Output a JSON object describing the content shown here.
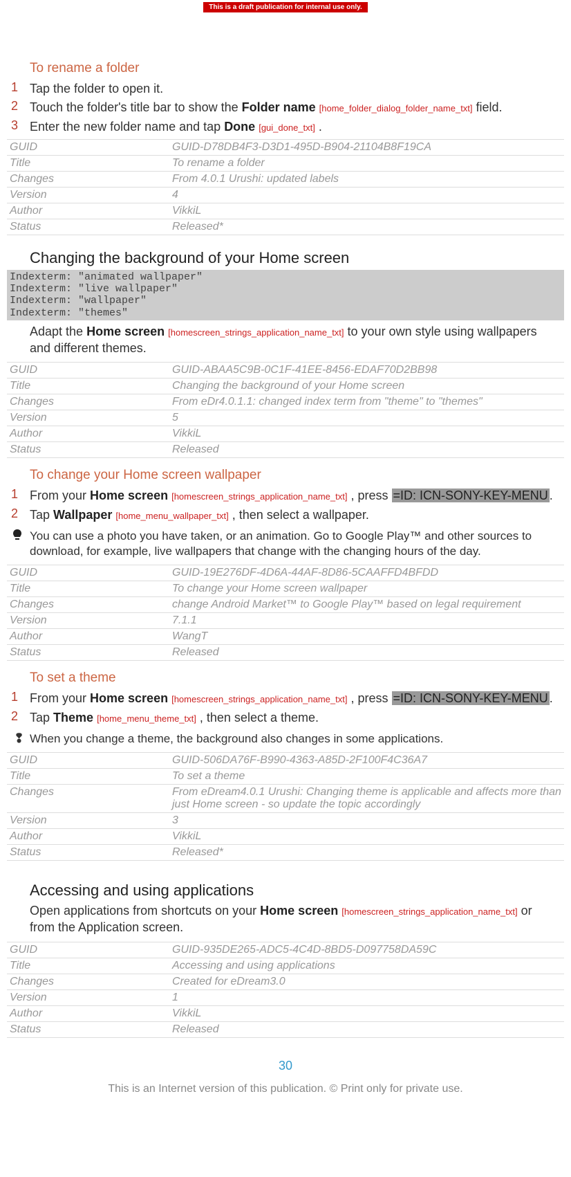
{
  "banner": "This is a draft publication for internal use only.",
  "sections": {
    "rename": {
      "heading": "To rename a folder",
      "steps": {
        "s1_text": "Tap the folder to open it.",
        "s2_pre": "Touch the folder's title bar to show the ",
        "s2_bold": "Folder name",
        "s2_ref": "[home_folder_dialog_folder_name_txt]",
        "s2_post": " field.",
        "s3_pre": "Enter the new folder name and tap ",
        "s3_bold": "Done",
        "s3_ref": "[gui_done_txt]",
        "s3_post": " ."
      },
      "meta": {
        "guid": "GUID-D78DB4F3-D3D1-495D-B904-21104B8F19CA",
        "title": "To rename a folder",
        "changes": "From 4.0.1 Urushi: updated labels",
        "version": "4",
        "author": "VikkiL",
        "status": "Released*"
      }
    },
    "changing_bg": {
      "heading": "Changing the background of your Home screen",
      "indexterms": "Indexterm: \"animated wallpaper\"\nIndexterm: \"live wallpaper\"\nIndexterm: \"wallpaper\"\nIndexterm: \"themes\"",
      "para_pre": "Adapt the ",
      "para_bold": "Home screen",
      "para_ref": "[homescreen_strings_application_name_txt]",
      "para_post": " to your own style using wallpapers and different themes.",
      "meta": {
        "guid": "GUID-ABAA5C9B-0C1F-41EE-8456-EDAF70D2BB98",
        "title": "Changing the background of your Home screen",
        "changes": "From eDr4.0.1.1: changed index term from \"theme\" to \"themes\"",
        "version": "5",
        "author": "VikkiL",
        "status": "Released"
      }
    },
    "change_wallpaper": {
      "heading": "To change your Home screen wallpaper",
      "steps": {
        "s1_pre": "From your ",
        "s1_bold": "Home screen",
        "s1_ref": "[homescreen_strings_application_name_txt]",
        "s1_mid": " , press ",
        "s1_icon": "=ID: ICN-SONY-KEY-MENU",
        "s1_post": ".",
        "s2_pre": "Tap ",
        "s2_bold": "Wallpaper",
        "s2_ref": "[home_menu_wallpaper_txt]",
        "s2_post": " , then select a wallpaper."
      },
      "tip": "You can use a photo you have taken, or an animation. Go to Google Play™ and other sources to download, for example, live wallpapers that change with the changing hours of the day.",
      "meta": {
        "guid": "GUID-19E276DF-4D6A-44AF-8D86-5CAAFFD4BFDD",
        "title": "To change your Home screen wallpaper",
        "changes": "change Android Market™ to Google Play™ based on legal requirement",
        "version": "7.1.1",
        "author": "WangT",
        "status": "Released"
      }
    },
    "set_theme": {
      "heading": "To set a theme",
      "steps": {
        "s1_pre": "From your ",
        "s1_bold": "Home screen",
        "s1_ref": "[homescreen_strings_application_name_txt]",
        "s1_mid": " , press ",
        "s1_icon": "=ID: ICN-SONY-KEY-MENU",
        "s1_post": ".",
        "s2_pre": "Tap ",
        "s2_bold": "Theme",
        "s2_ref": "[home_menu_theme_txt]",
        "s2_post": " , then select a theme."
      },
      "note": "When you change a theme, the background also changes in some applications.",
      "meta": {
        "guid": "GUID-506DA76F-B990-4363-A85D-2F100F4C36A7",
        "title": "To set a theme",
        "changes": "From eDream4.0.1 Urushi: Changing theme is applicable and affects more than just Home screen - so update the topic accordingly",
        "version": "3",
        "author": "VikkiL",
        "status": "Released*"
      }
    },
    "accessing": {
      "heading": "Accessing and using applications",
      "para_pre": "Open applications from shortcuts on your ",
      "para_bold": "Home screen",
      "para_ref": "[homescreen_strings_application_name_txt]",
      "para_post": " or from the Application screen.",
      "meta": {
        "guid": "GUID-935DE265-ADC5-4C4D-8BD5-D097758DA59C",
        "title": "Accessing and using applications",
        "changes": "Created for eDream3.0",
        "version": "1",
        "author": "VikkiL",
        "status": "Released"
      }
    }
  },
  "meta_labels": {
    "guid": "GUID",
    "title": "Title",
    "changes": "Changes",
    "version": "Version",
    "author": "Author",
    "status": "Status"
  },
  "step_nums": {
    "n1": "1",
    "n2": "2",
    "n3": "3"
  },
  "page_number": "30",
  "footer": "This is an Internet version of this publication. © Print only for private use."
}
